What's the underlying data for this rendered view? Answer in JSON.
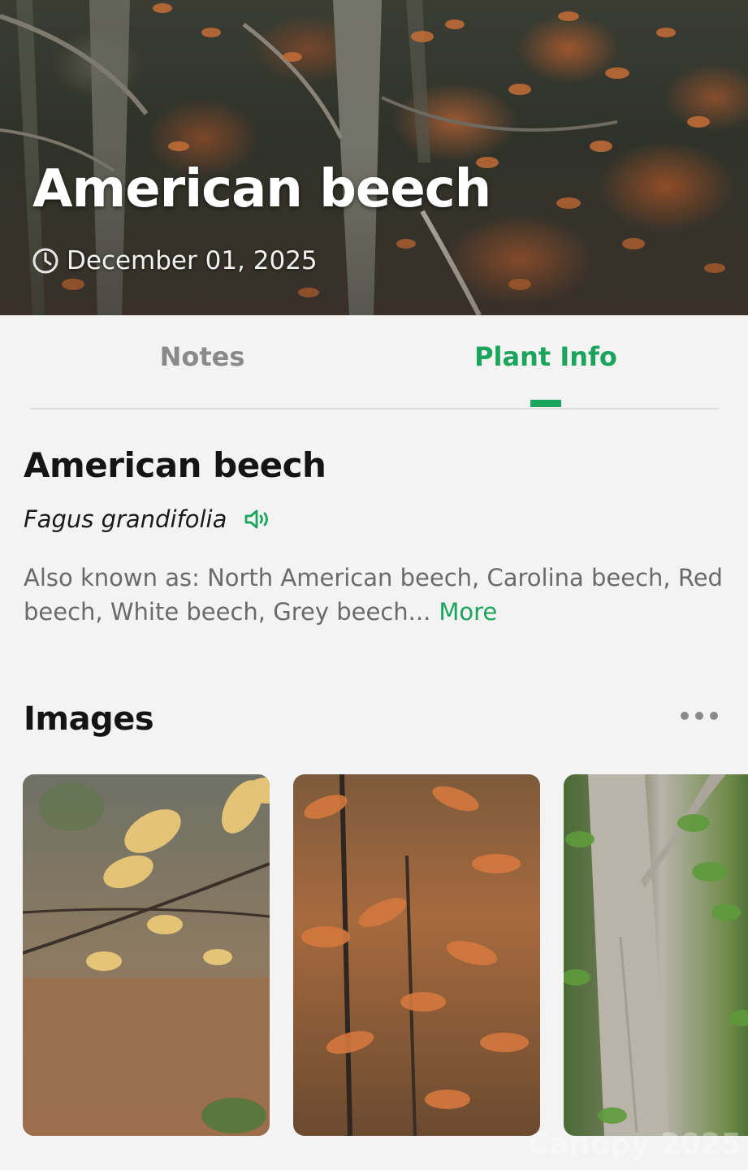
{
  "hero": {
    "title": "American beech",
    "date": "December 01, 2025",
    "date_icon": "clock-icon"
  },
  "tabs": [
    {
      "label": "Notes",
      "active": false
    },
    {
      "label": "Plant Info",
      "active": true
    }
  ],
  "plant": {
    "common_name": "American beech",
    "scientific_name": "Fagus grandifolia",
    "pronounce_icon": "speaker-icon",
    "aka_text": "Also known as: North American beech, Carolina beech, Red beech, White beech, Grey beech...",
    "more_label": "More"
  },
  "images": {
    "title": "Images",
    "more_icon": "ellipsis-icon",
    "thumbnails": [
      {
        "subject": "yellow beech leaves on branch"
      },
      {
        "subject": "orange autumn beech foliage"
      },
      {
        "subject": "smooth grey beech trunk"
      }
    ]
  },
  "watermark": "Canopy 2025",
  "colors": {
    "accent": "#1ca35c",
    "background": "#f3f3f4",
    "muted_text": "#6a6a6c",
    "tab_inactive": "#8a8a8c"
  }
}
